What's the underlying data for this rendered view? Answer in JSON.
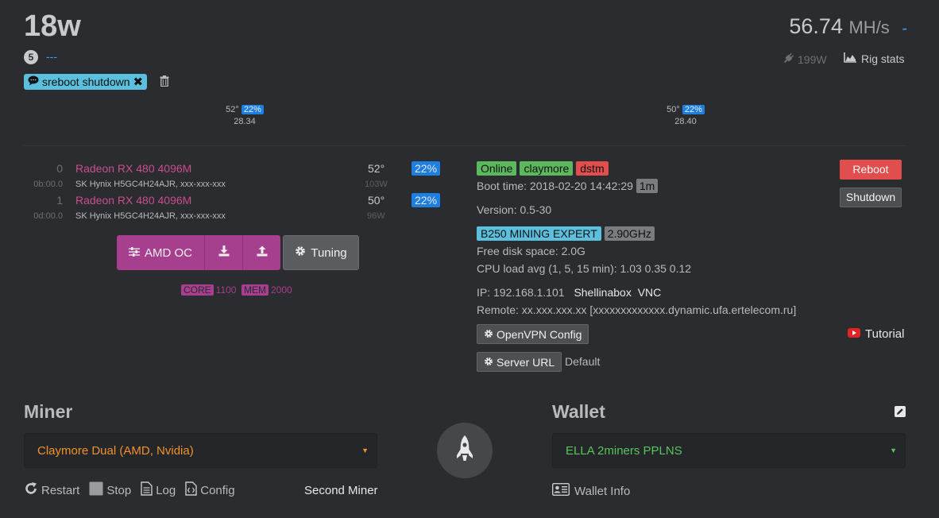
{
  "header": {
    "rig_name": "18w",
    "rig_id": "5",
    "rig_description": "---",
    "command_tag": "sreboot shutdown",
    "hashrate_value": "56.74",
    "hashrate_unit": "MH/s",
    "hashrate_extra": "-",
    "power": "199W",
    "rig_stats_label": "Rig stats"
  },
  "gpu_summary": [
    {
      "temp": "52°",
      "fan": "22%",
      "hash": "28.34"
    },
    {
      "temp": "50°",
      "fan": "22%",
      "hash": "28.40"
    }
  ],
  "gpus": [
    {
      "index": "0",
      "bus": "0b:00.0",
      "name": "Radeon RX 480 4096M",
      "memory": "SK Hynix H5GC4H24AJR, xxx-xxx-xxx",
      "temp": "52°",
      "watt": "103W",
      "fan": "22%"
    },
    {
      "index": "1",
      "bus": "0d:00.0",
      "name": "Radeon RX 480 4096M",
      "memory": "SK Hynix H5GC4H24AJR, xxx-xxx-xxx",
      "temp": "50°",
      "watt": "96W",
      "fan": "22%"
    }
  ],
  "oc": {
    "amd_oc_label": "AMD OC",
    "tuning_label": "Tuning",
    "core_label": "CORE",
    "core_value": "1100",
    "mem_label": "MEM",
    "mem_value": "2000"
  },
  "status": {
    "badges": [
      {
        "label": "Online",
        "color": "#5cb85c"
      },
      {
        "label": "claymore",
        "color": "#5cb85c"
      },
      {
        "label": "dstm",
        "color": "#e04e4e"
      }
    ],
    "boot_time": "Boot time: 2018-02-20 14:42:29",
    "uptime_badge": "1m",
    "version": "Version: 0.5-30",
    "motherboard": "B250 MINING EXPERT",
    "cpu_freq": "2.90GHz",
    "disk": "Free disk space: 2.0G",
    "cpu_load": "CPU load avg (1, 5, 15 min): 1.03 0.35 0.12",
    "ip": "IP: 192.168.1.101",
    "shellinabox": "Shellinabox",
    "vnc": "VNC",
    "remote": "Remote: xx.xxx.xxx.xx [xxxxxxxxxxxxx.dynamic.ufa.ertelecom.ru]",
    "openvpn_label": "OpenVPN Config",
    "server_url_label": "Server URL",
    "server_url_value": "Default",
    "reboot_label": "Reboot",
    "shutdown_label": "Shutdown",
    "tutorial_label": "Tutorial"
  },
  "miner": {
    "title": "Miner",
    "selected": "Claymore Dual (AMD, Nvidia)",
    "restart_label": "Restart",
    "stop_label": "Stop",
    "log_label": "Log",
    "config_label": "Config",
    "second_miner_label": "Second Miner"
  },
  "wallet": {
    "title": "Wallet",
    "selected": "ELLA 2miners PPLNS",
    "info_label": "Wallet Info"
  },
  "colors": {
    "accent_blue": "#1d7fe0",
    "oc_purple": "#a53f8e",
    "miner_orange": "#f0922a",
    "wallet_green": "#58c45a"
  }
}
